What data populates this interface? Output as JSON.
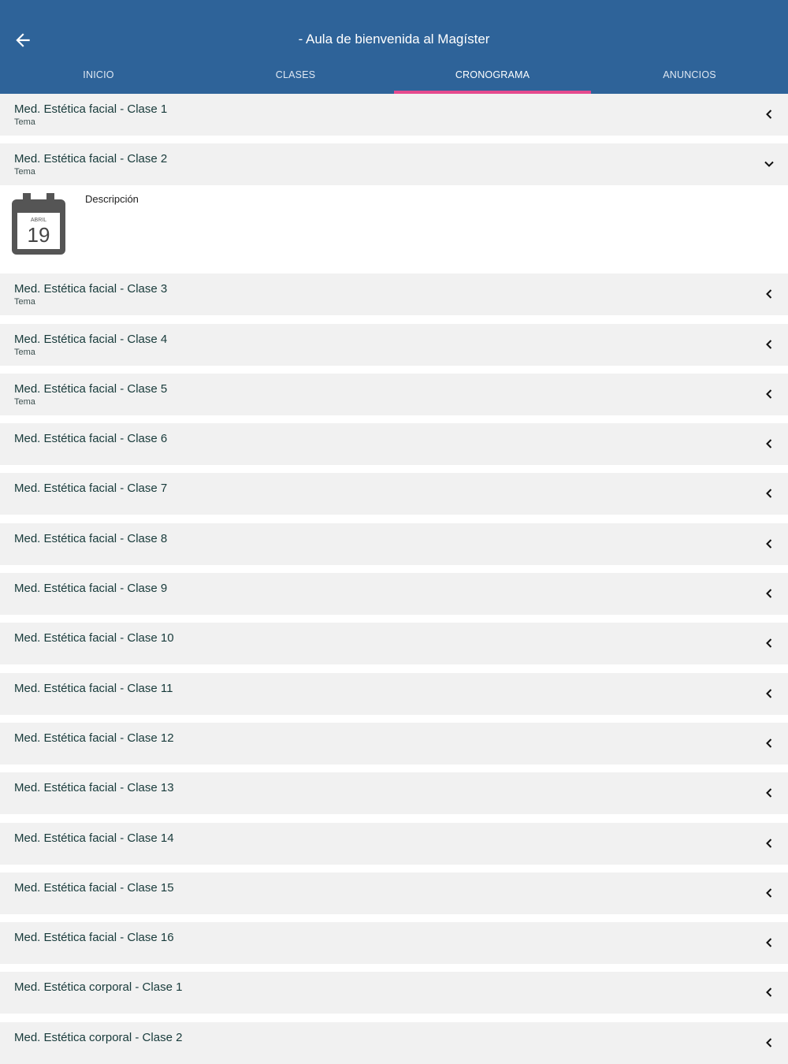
{
  "header": {
    "title": "- Aula de bienvenida al Magíster",
    "back_icon": "arrow-left-icon",
    "colors": {
      "bar": "#2e6399",
      "indicator": "#e54a8e"
    }
  },
  "tabs": [
    {
      "label": "INICIO",
      "active": false
    },
    {
      "label": "CLASES",
      "active": false
    },
    {
      "label": "CRONOGRAMA",
      "active": true
    },
    {
      "label": "ANUNCIOS",
      "active": false
    }
  ],
  "items": [
    {
      "title": "Med. Estética facial - Clase 1",
      "subtitle": "Tema"
    },
    {
      "title": "Med. Estética facial - Clase 2",
      "subtitle": "Tema",
      "expanded": true,
      "detail": {
        "calendar_month": "ABRIL",
        "calendar_day": "19",
        "description_label": "Descripción"
      }
    },
    {
      "title": "Med. Estética facial - Clase 3",
      "subtitle": "Tema"
    },
    {
      "title": "Med. Estética facial - Clase 4",
      "subtitle": "Tema"
    },
    {
      "title": "Med. Estética facial - Clase 5",
      "subtitle": "Tema"
    },
    {
      "title": "Med. Estética facial - Clase 6"
    },
    {
      "title": "Med. Estética facial - Clase 7"
    },
    {
      "title": "Med. Estética facial - Clase 8"
    },
    {
      "title": "Med. Estética facial - Clase 9"
    },
    {
      "title": "Med. Estética facial - Clase 10"
    },
    {
      "title": "Med. Estética facial - Clase 11"
    },
    {
      "title": "Med. Estética facial - Clase 12"
    },
    {
      "title": "Med. Estética facial - Clase 13"
    },
    {
      "title": "Med. Estética facial - Clase 14"
    },
    {
      "title": "Med. Estética facial - Clase 15"
    },
    {
      "title": "Med. Estética facial - Clase 16"
    },
    {
      "title": "Med. Estética corporal - Clase 1"
    },
    {
      "title": "Med. Estética corporal - Clase 2"
    }
  ]
}
